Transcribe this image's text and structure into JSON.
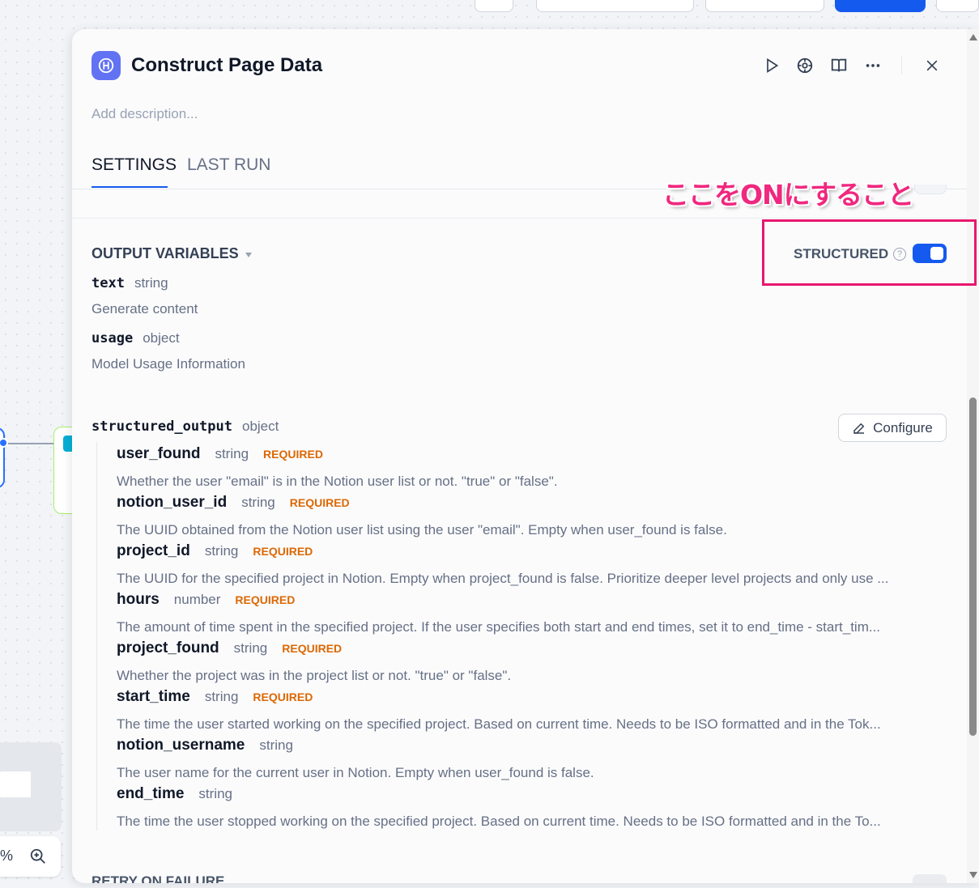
{
  "panel": {
    "title": "Construct Page Data",
    "description_placeholder": "Add description...",
    "tabs": [
      {
        "label": "SETTINGS",
        "active": true
      },
      {
        "label": "LAST RUN",
        "active": false
      }
    ]
  },
  "output_variables": {
    "title": "OUTPUT VARIABLES",
    "structured_label": "STRUCTURED",
    "structured_enabled": true,
    "variables": [
      {
        "name": "text",
        "type": "string",
        "description": "Generate content"
      },
      {
        "name": "usage",
        "type": "object",
        "description": "Model Usage Information"
      }
    ],
    "structured_output": {
      "name": "structured_output",
      "type": "object",
      "configure_label": "Configure",
      "fields": [
        {
          "name": "user_found",
          "type": "string",
          "required": "REQUIRED",
          "description": "Whether the user \"email\" is in the Notion user list or not. \"true\" or \"false\"."
        },
        {
          "name": "notion_user_id",
          "type": "string",
          "required": "REQUIRED",
          "description": "The UUID obtained from the Notion user list using the user \"email\". Empty when user_found is false."
        },
        {
          "name": "project_id",
          "type": "string",
          "required": "REQUIRED",
          "description": "The UUID for the specified project in Notion. Empty when project_found is false. Prioritize deeper level projects and only use ..."
        },
        {
          "name": "hours",
          "type": "number",
          "required": "REQUIRED",
          "description": "The amount of time spent in the specified project. If the user specifies both start and end times, set it to end_time - start_tim..."
        },
        {
          "name": "project_found",
          "type": "string",
          "required": "REQUIRED",
          "description": "Whether the project was in the project list or not. \"true\" or \"false\"."
        },
        {
          "name": "start_time",
          "type": "string",
          "required": "REQUIRED",
          "description": "The time the user started working on the specified project. Based on current time. Needs to be ISO formatted and in the Tok..."
        },
        {
          "name": "notion_username",
          "type": "string",
          "required": "",
          "description": "The user name for the current user in Notion. Empty when user_found is false."
        },
        {
          "name": "end_time",
          "type": "string",
          "required": "",
          "description": "The time the user stopped working on the specified project. Based on current time. Needs to be ISO formatted and in the To..."
        }
      ]
    }
  },
  "retry_label": "RETRY ON FAILURE",
  "canvas": {
    "zoom_fragment": "%"
  },
  "annotation": {
    "text": "ここをONにすること"
  },
  "colors": {
    "accent": "#155aef",
    "annotation": "#e8176d",
    "required": "#dc6803"
  }
}
